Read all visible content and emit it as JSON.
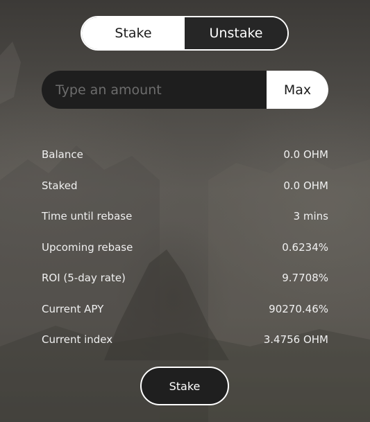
{
  "tabs": {
    "stake_label": "Stake",
    "unstake_label": "Unstake",
    "active": "Stake"
  },
  "amount": {
    "placeholder": "Type an amount",
    "value": "",
    "max_label": "Max"
  },
  "stats": [
    {
      "label": "Balance",
      "value": "0.0 OHM"
    },
    {
      "label": "Staked",
      "value": "0.0 OHM"
    },
    {
      "label": "Time until rebase",
      "value": "3 mins"
    },
    {
      "label": "Upcoming rebase",
      "value": "0.6234%"
    },
    {
      "label": "ROI (5-day rate)",
      "value": "9.7708%"
    },
    {
      "label": "Current APY",
      "value": "90270.46%"
    },
    {
      "label": "Current index",
      "value": "3.4756 OHM"
    }
  ],
  "action": {
    "stake_button_label": "Stake"
  },
  "colors": {
    "panel_dark": "#1e1e1e",
    "accent_light": "#ffffff"
  }
}
